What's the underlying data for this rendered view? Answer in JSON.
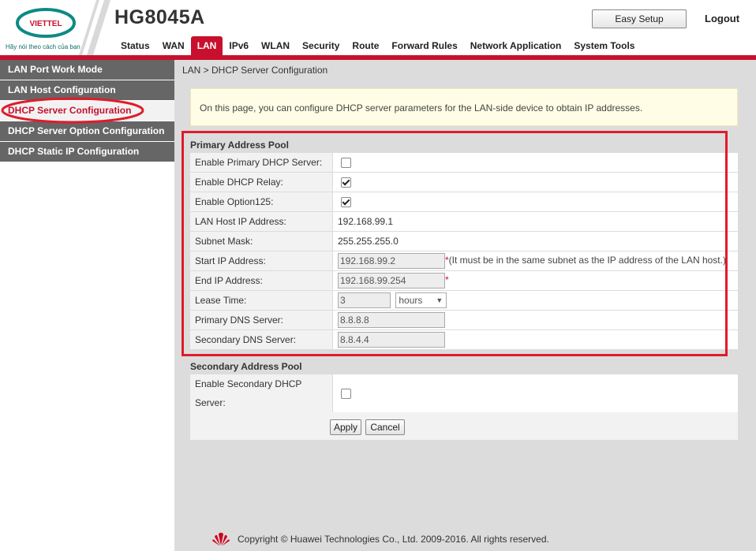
{
  "brand": {
    "logo_text": "VIETTEL",
    "slogan": "Hãy nói theo cách của bạn",
    "model": "HG8045A",
    "accent_color": "#c8102e"
  },
  "header": {
    "easy_setup": "Easy Setup",
    "logout": "Logout",
    "nav": [
      "Status",
      "WAN",
      "LAN",
      "IPv6",
      "WLAN",
      "Security",
      "Route",
      "Forward Rules",
      "Network Application",
      "System Tools"
    ],
    "active_nav": "LAN"
  },
  "sidebar": {
    "items": [
      {
        "label": "LAN Port Work Mode"
      },
      {
        "label": "LAN Host Configuration"
      },
      {
        "label": "DHCP Server Configuration",
        "active": true
      },
      {
        "label": "DHCP Server Option Configuration"
      },
      {
        "label": "DHCP Static IP Configuration"
      }
    ]
  },
  "main": {
    "breadcrumb": "LAN > DHCP Server Configuration",
    "info": "On this page, you can configure DHCP server parameters for the LAN-side device to obtain IP addresses.",
    "primary_pool": {
      "title": "Primary Address Pool",
      "enable_dhcp_server": {
        "label": "Enable Primary DHCP Server:",
        "checked": false
      },
      "enable_dhcp_relay": {
        "label": "Enable DHCP Relay:",
        "checked": true
      },
      "enable_option125": {
        "label": "Enable Option125:",
        "checked": true
      },
      "lan_host_ip": {
        "label": "LAN Host IP Address:",
        "value": "192.168.99.1"
      },
      "subnet_mask": {
        "label": "Subnet Mask:",
        "value": "255.255.255.0"
      },
      "start_ip": {
        "label": "Start IP Address:",
        "value": "192.168.99.2",
        "required": "*",
        "note": "(It must be in the same subnet as the IP address of the LAN host.)"
      },
      "end_ip": {
        "label": "End IP Address:",
        "value": "192.168.99.254",
        "required": "*"
      },
      "lease_time": {
        "label": "Lease Time:",
        "value": "3",
        "unit": "hours"
      },
      "primary_dns": {
        "label": "Primary DNS Server:",
        "value": "8.8.8.8"
      },
      "secondary_dns": {
        "label": "Secondary DNS Server:",
        "value": "8.8.4.4"
      }
    },
    "secondary_pool": {
      "title": "Secondary Address Pool",
      "enable_label_line1": "Enable Secondary DHCP",
      "enable_label_line2": "Server:",
      "checked": false
    },
    "buttons": {
      "apply": "Apply",
      "cancel": "Cancel"
    }
  },
  "footer": {
    "copyright": "Copyright © Huawei Technologies Co., Ltd. 2009-2016. All rights reserved."
  },
  "icons": [
    "viettel-logo-icon",
    "huawei-logo-icon",
    "chevron-down-icon",
    "checkbox-icon"
  ]
}
